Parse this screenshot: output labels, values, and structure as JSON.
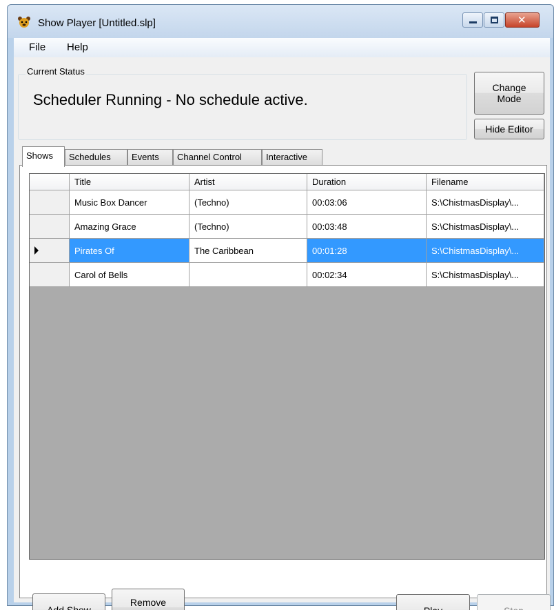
{
  "window": {
    "title": "Show Player [Untitled.slp]",
    "icon": "app-bear-icon",
    "controls": {
      "minimize": "minimize-icon",
      "maximize": "maximize-icon",
      "close": "close-icon",
      "close_glyph": "✕"
    }
  },
  "menu": {
    "items": [
      "File",
      "Help"
    ]
  },
  "status": {
    "group_label": "Current Status",
    "text": "Scheduler Running - No schedule active."
  },
  "buttons": {
    "change_mode": "Change\nMode",
    "hide_editor": "Hide Editor",
    "add_show": "Add Show",
    "remove_show": "Remove\nShow",
    "play": "Play",
    "stop": "Stop"
  },
  "tabs": [
    {
      "label": "Shows",
      "active": true
    },
    {
      "label": "Schedules",
      "active": false
    },
    {
      "label": "Events",
      "active": false
    },
    {
      "label": "Channel Control",
      "active": false
    },
    {
      "label": "Interactive",
      "active": false
    }
  ],
  "shows_grid": {
    "columns": [
      "Title",
      "Artist",
      "Duration",
      "Filename"
    ],
    "rows": [
      {
        "title": "Music Box Dancer",
        "artist": "(Techno)",
        "duration": "00:03:06",
        "filename": "S:\\ChistmasDisplay\\...",
        "selected": false
      },
      {
        "title": "Amazing Grace",
        "artist": "(Techno)",
        "duration": "00:03:48",
        "filename": "S:\\ChistmasDisplay\\...",
        "selected": false
      },
      {
        "title": "Pirates Of",
        "artist": "The Caribbean",
        "duration": "00:01:28",
        "filename": "S:\\ChistmasDisplay\\...",
        "selected": true
      },
      {
        "title": "Carol of Bells",
        "artist": "",
        "duration": "00:02:34",
        "filename": "S:\\ChistmasDisplay\\...",
        "selected": false
      }
    ]
  },
  "colors": {
    "selection": "#3399ff",
    "grid_background": "#ababab",
    "window_frame": "#b9d1ea"
  }
}
